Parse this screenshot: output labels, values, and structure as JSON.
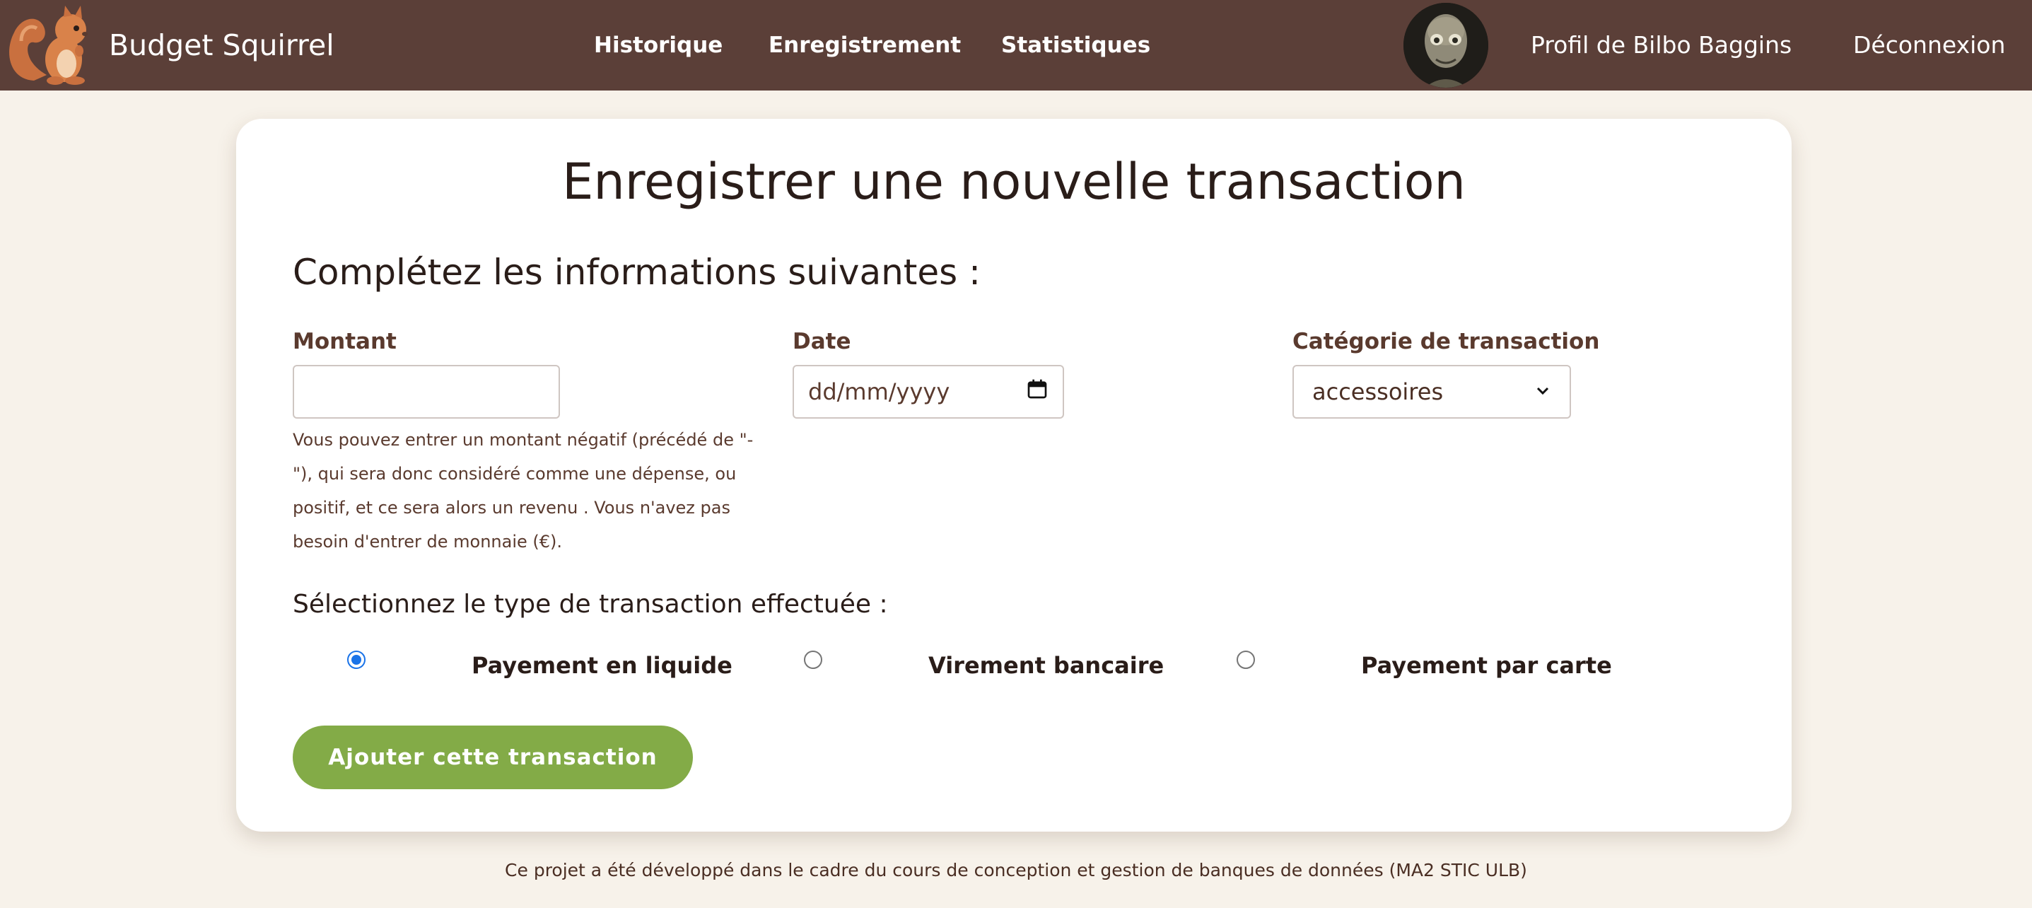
{
  "navbar": {
    "brand_name": "Budget Squirrel",
    "links": [
      "Historique",
      "Enregistrement",
      "Statistiques"
    ],
    "profile_label": "Profil de Bilbo Baggins",
    "logout_label": "Déconnexion",
    "logo_icon": "squirrel-icon",
    "avatar_icon": "user-avatar"
  },
  "form": {
    "title": "Enregistrer une nouvelle transaction",
    "section_title": "Complétez les informations suivantes :",
    "amount_label": "Montant",
    "amount_value": "",
    "amount_help": "Vous pouvez entrer un montant négatif (précédé de \"-\"), qui sera donc considéré comme une dépense, ou positif, et ce sera alors un revenu . Vous n'avez pas besoin d'entrer de monnaie (€).",
    "date_label": "Date",
    "date_placeholder": "dd/mm/yyyy",
    "category_label": "Catégorie de transaction",
    "category_value": "accessoires",
    "radio_title": "Sélectionnez le type de transaction effectuée :",
    "radio_options": [
      {
        "label": "Payement en liquide",
        "checked": true
      },
      {
        "label": "Virement bancaire",
        "checked": false
      },
      {
        "label": "Payement par carte",
        "checked": false
      }
    ],
    "submit_label": "Ajouter cette transaction"
  },
  "footer": {
    "text": "Ce projet a été développé dans le cadre du cours de conception et gestion de banques de données (MA2 STIC ULB)"
  },
  "colors": {
    "navbar_bg": "#5b3f38",
    "page_bg": "#f7f2ea",
    "accent_green": "#83ab47",
    "radio_blue": "#1a73e8"
  }
}
